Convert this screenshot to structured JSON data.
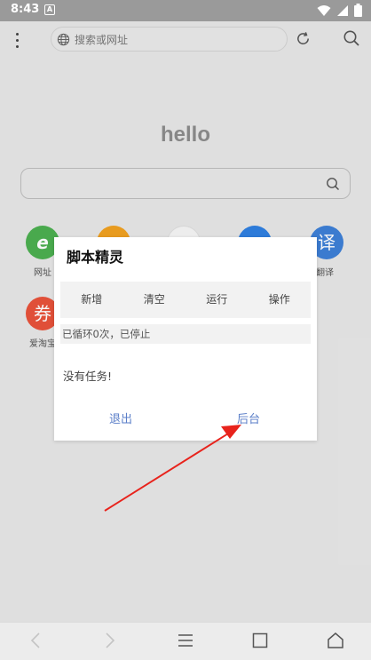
{
  "status_bar": {
    "time": "8:43",
    "notification_badge": "A"
  },
  "browser": {
    "url_placeholder": "搜索或网址"
  },
  "home": {
    "title": "hello",
    "shortcuts": [
      {
        "label": "网址",
        "glyph": "e",
        "color": "#4caf50"
      },
      {
        "label": "",
        "glyph": "",
        "color": "#f0a020"
      },
      {
        "label": "",
        "glyph": "",
        "color": "#ffffff"
      },
      {
        "label": "",
        "glyph": "",
        "color": "#2f7fe0"
      },
      {
        "label": "翻译",
        "glyph": "译",
        "color": "#3d7fd6"
      },
      {
        "label": "爱淘宝",
        "glyph": "券",
        "color": "#e8523a"
      }
    ]
  },
  "dialog": {
    "title": "脚本精灵",
    "tabs": [
      "新增",
      "清空",
      "运行",
      "操作"
    ],
    "status": "已循环0次，已停止",
    "empty_message": "没有任务!",
    "exit_label": "退出",
    "background_label": "后台"
  },
  "colors": {
    "accent": "#5a7ec8",
    "arrow": "#e8231c"
  }
}
